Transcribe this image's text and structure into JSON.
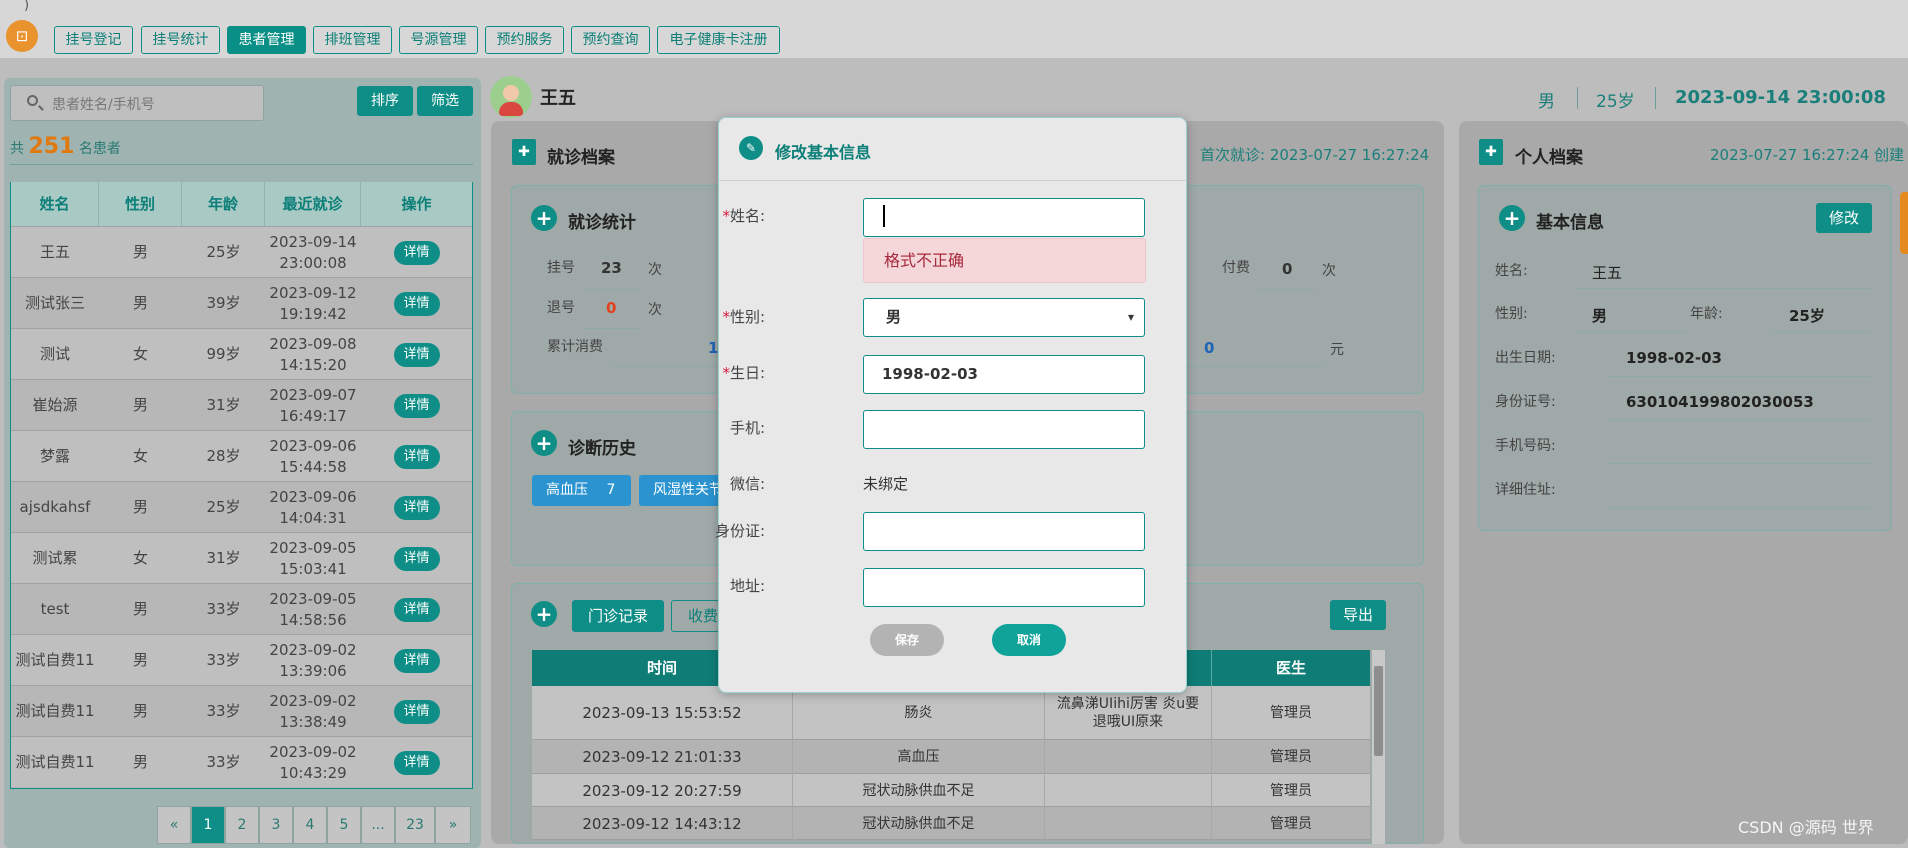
{
  "nav": {
    "logo_tail": ")",
    "tabs": [
      {
        "label": "挂号登记",
        "active": false
      },
      {
        "label": "挂号统计",
        "active": false
      },
      {
        "label": "患者管理",
        "active": true
      },
      {
        "label": "排班管理",
        "active": false
      },
      {
        "label": "号源管理",
        "active": false
      },
      {
        "label": "预约服务",
        "active": false
      },
      {
        "label": "预约查询",
        "active": false
      },
      {
        "label": "电子健康卡注册",
        "active": false
      }
    ]
  },
  "patients_panel": {
    "search_placeholder": "患者姓名/手机号",
    "sort_label": "排序",
    "filter_label": "筛选",
    "count_prefix": "共",
    "count_value": "251",
    "count_suffix": "名患者",
    "columns": [
      "姓名",
      "性别",
      "年龄",
      "最近就诊",
      "操作"
    ],
    "rows": [
      {
        "name": "王五",
        "gender": "男",
        "age": "25岁",
        "date": "2023-09-14",
        "time": "23:00:08",
        "action": "详情"
      },
      {
        "name": "测试张三",
        "gender": "男",
        "age": "39岁",
        "date": "2023-09-12",
        "time": "19:19:42",
        "action": "详情"
      },
      {
        "name": "测试",
        "gender": "女",
        "age": "99岁",
        "date": "2023-09-08",
        "time": "14:15:20",
        "action": "详情"
      },
      {
        "name": "崔始源",
        "gender": "男",
        "age": "31岁",
        "date": "2023-09-07",
        "time": "16:49:17",
        "action": "详情"
      },
      {
        "name": "梦露",
        "gender": "女",
        "age": "28岁",
        "date": "2023-09-06",
        "time": "15:44:58",
        "action": "详情"
      },
      {
        "name": "ajsdkahsf",
        "gender": "男",
        "age": "25岁",
        "date": "2023-09-06",
        "time": "14:04:31",
        "action": "详情"
      },
      {
        "name": "测试累",
        "gender": "女",
        "age": "31岁",
        "date": "2023-09-05",
        "time": "15:03:41",
        "action": "详情"
      },
      {
        "name": "test",
        "gender": "男",
        "age": "33岁",
        "date": "2023-09-05",
        "time": "14:58:56",
        "action": "详情"
      },
      {
        "name": "测试自费11",
        "gender": "男",
        "age": "33岁",
        "date": "2023-09-02",
        "time": "13:39:06",
        "action": "详情"
      },
      {
        "name": "测试自费11",
        "gender": "男",
        "age": "33岁",
        "date": "2023-09-02",
        "time": "13:38:49",
        "action": "详情"
      },
      {
        "name": "测试自费11",
        "gender": "男",
        "age": "33岁",
        "date": "2023-09-02",
        "time": "10:43:29",
        "action": "详情"
      }
    ],
    "pagination": {
      "prev": "«",
      "pages": [
        "1",
        "2",
        "3",
        "4",
        "5",
        "...",
        "23"
      ],
      "next": "»",
      "current": "1"
    }
  },
  "patient_header": {
    "name": "王五",
    "gender": "男",
    "age": "25岁",
    "datetime": "2023-09-14 23:00:08"
  },
  "visit_record": {
    "title": "就诊档案",
    "first_visit_prefix": "首次就诊:",
    "first_visit": "2023-07-27 16:27:24",
    "stats": {
      "title": "就诊统计",
      "register_label": "挂号",
      "register_value": "23",
      "register_unit": "次",
      "cancel_label": "退号",
      "cancel_value": "0",
      "cancel_unit": "次",
      "pay_label": "付费",
      "pay_value": "0",
      "pay_unit": "次",
      "total_label": "累计消费",
      "total_value_partial": "1",
      "total_value2": "0",
      "total_unit": "元"
    },
    "diagnosis": {
      "title": "诊断历史",
      "tags": [
        {
          "label": "高血压",
          "count": "7"
        },
        {
          "label": "风湿性关节"
        }
      ]
    },
    "outpatient": {
      "tab_active": "门诊记录",
      "tab_other": "收费",
      "export_label": "导出",
      "columns": [
        "时间",
        "医生"
      ],
      "rows": [
        {
          "time": "2023-09-13 15:53:52",
          "diagnosis": "肠炎",
          "note": "流鼻涕UIihi厉害 炎u要退哦UI原来",
          "doctor": "管理员"
        },
        {
          "time": "2023-09-12 21:01:33",
          "diagnosis": "高血压",
          "note": "",
          "doctor": "管理员"
        },
        {
          "time": "2023-09-12 20:27:59",
          "diagnosis": "冠状动脉供血不足",
          "note": "",
          "doctor": "管理员"
        },
        {
          "time": "2023-09-12 14:43:12",
          "diagnosis": "冠状动脉供血不足",
          "note": "",
          "doctor": "管理员"
        }
      ]
    }
  },
  "personal_record": {
    "title": "个人档案",
    "created_prefix": "2023-07-27 16:27:24",
    "created_suffix": "创建",
    "basic_title": "基本信息",
    "edit_label": "修改",
    "name_label": "姓名:",
    "name_value": "王五",
    "gender_label": "性别:",
    "gender_value": "男",
    "age_label": "年龄:",
    "age_value": "25岁",
    "birth_label": "出生日期:",
    "birth_value": "1998-02-03",
    "id_label": "身份证号:",
    "id_value": "630104199802030053",
    "phone_label": "手机号码:",
    "phone_value": "",
    "address_label": "详细住址:",
    "address_value": ""
  },
  "modal": {
    "title": "修改基本信息",
    "name_label": "姓名:",
    "name_value": "",
    "name_error": "格式不正确",
    "gender_label": "性别:",
    "gender_value": "男",
    "birth_label": "生日:",
    "birth_value": "1998-02-03",
    "phone_label": "手机:",
    "phone_value": "",
    "wechat_label": "微信:",
    "wechat_value": "未绑定",
    "id_label": "身份证:",
    "id_value": "",
    "address_label": "地址:",
    "address_value": "",
    "save_label": "保存",
    "cancel_label": "取消",
    "required_mark": "*"
  },
  "watermark": "CSDN @源码 世界",
  "colors": {
    "accent": "#0e8e87",
    "error_bg": "#f5d6d9",
    "count": "#e07a10"
  }
}
